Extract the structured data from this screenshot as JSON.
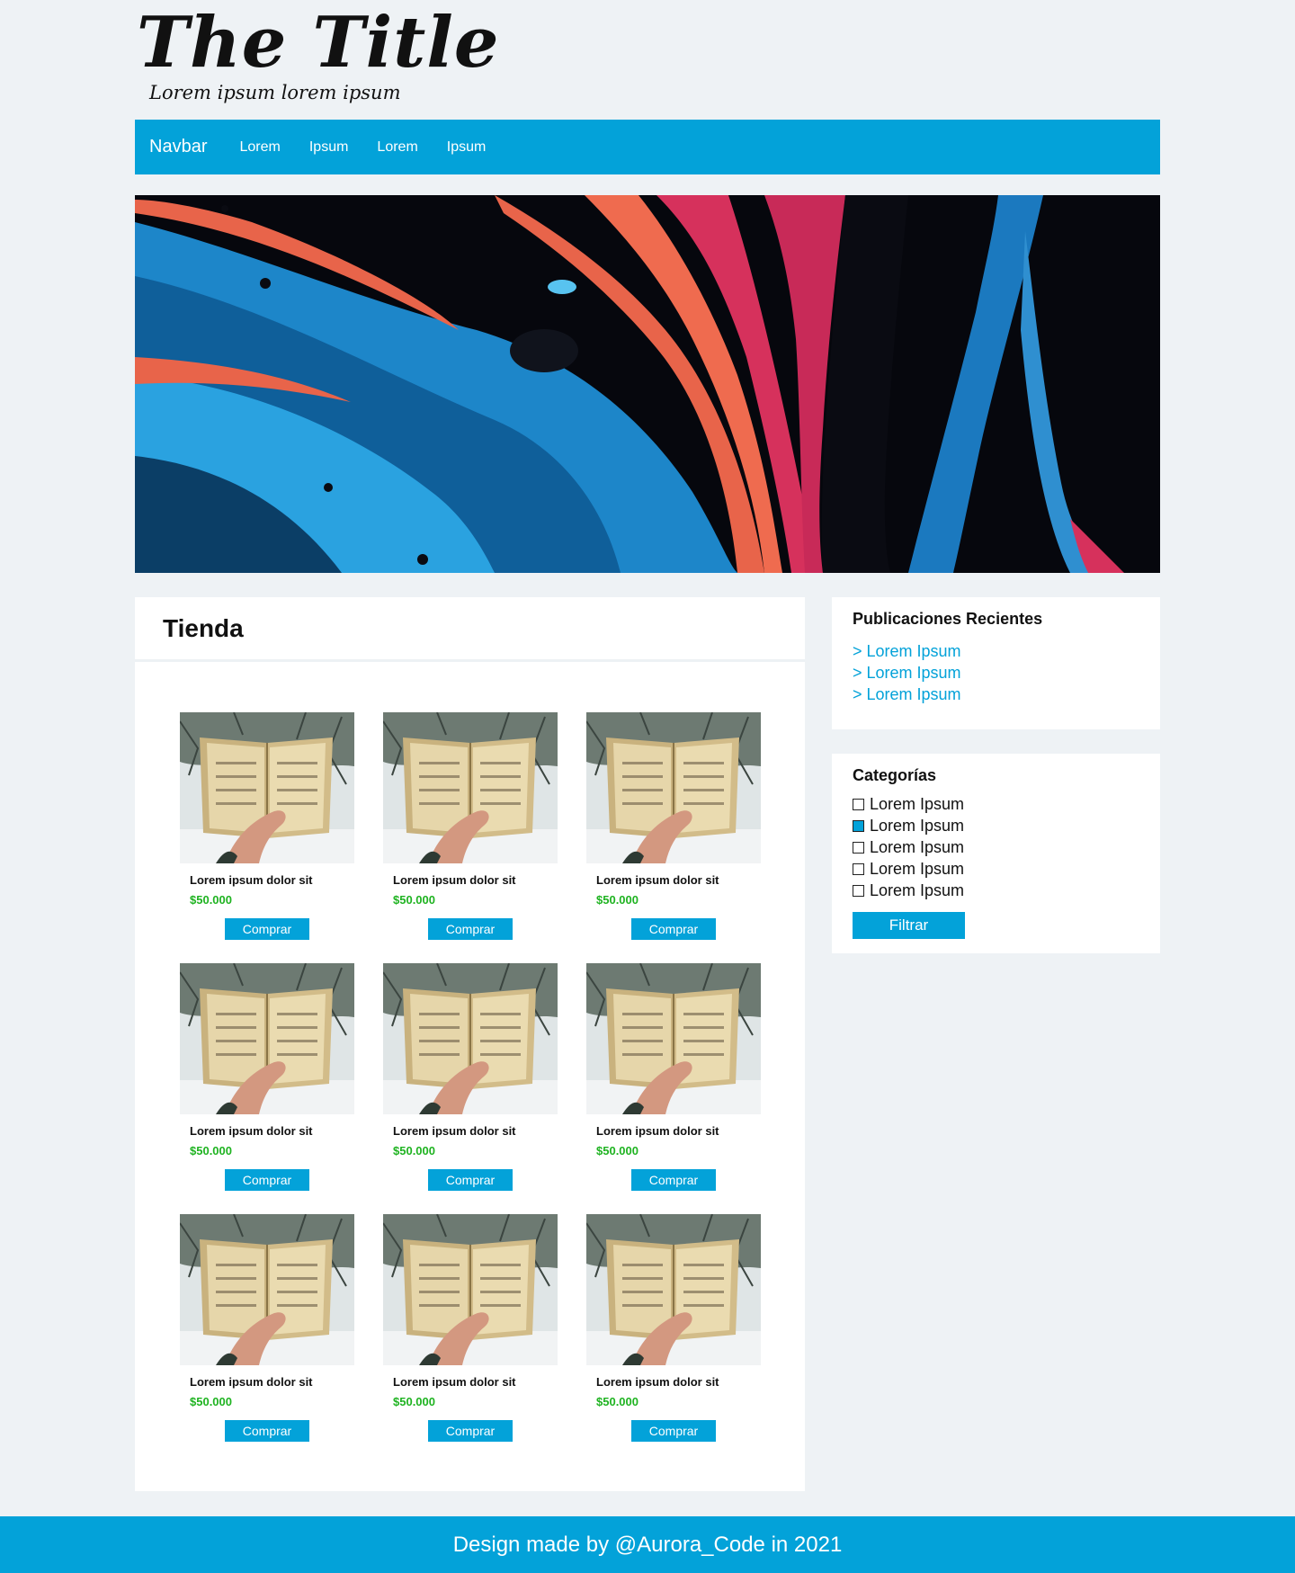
{
  "header": {
    "title": "The Title",
    "subtitle": "Lorem ipsum lorem ipsum"
  },
  "navbar": {
    "brand": "Navbar",
    "links": [
      "Lorem",
      "Ipsum",
      "Lorem",
      "Ipsum"
    ]
  },
  "hero": {
    "image": "abstract-paint-banner"
  },
  "shop": {
    "title": "Tienda",
    "products": [
      {
        "name": "Lorem ipsum dolor sit",
        "price": "$50.000",
        "button": "Comprar",
        "image": "open-book-in-hand"
      },
      {
        "name": "Lorem ipsum dolor sit",
        "price": "$50.000",
        "button": "Comprar",
        "image": "open-book-in-hand"
      },
      {
        "name": "Lorem ipsum dolor sit",
        "price": "$50.000",
        "button": "Comprar",
        "image": "open-book-in-hand"
      },
      {
        "name": "Lorem ipsum dolor sit",
        "price": "$50.000",
        "button": "Comprar",
        "image": "open-book-in-hand"
      },
      {
        "name": "Lorem ipsum dolor sit",
        "price": "$50.000",
        "button": "Comprar",
        "image": "open-book-in-hand"
      },
      {
        "name": "Lorem ipsum dolor sit",
        "price": "$50.000",
        "button": "Comprar",
        "image": "open-book-in-hand"
      },
      {
        "name": "Lorem ipsum dolor sit",
        "price": "$50.000",
        "button": "Comprar",
        "image": "open-book-in-hand"
      },
      {
        "name": "Lorem ipsum dolor sit",
        "price": "$50.000",
        "button": "Comprar",
        "image": "open-book-in-hand"
      },
      {
        "name": "Lorem ipsum dolor sit",
        "price": "$50.000",
        "button": "Comprar",
        "image": "open-book-in-hand"
      }
    ]
  },
  "sidebar": {
    "recent": {
      "title": "Publicaciones Recientes",
      "links": [
        "> Lorem Ipsum",
        "> Lorem Ipsum",
        "> Lorem Ipsum"
      ]
    },
    "categories": {
      "title": "Categorías",
      "items": [
        {
          "label": "Lorem Ipsum",
          "checked": false
        },
        {
          "label": "Lorem Ipsum",
          "checked": true
        },
        {
          "label": "Lorem Ipsum",
          "checked": false
        },
        {
          "label": "Lorem Ipsum",
          "checked": false
        },
        {
          "label": "Lorem Ipsum",
          "checked": false
        }
      ],
      "button": "Filtrar"
    }
  },
  "footer": {
    "text": "Design made by @Aurora_Code in 2021"
  },
  "colors": {
    "accent": "#03a2d9",
    "background": "#eef2f5",
    "price": "#1fb321"
  }
}
